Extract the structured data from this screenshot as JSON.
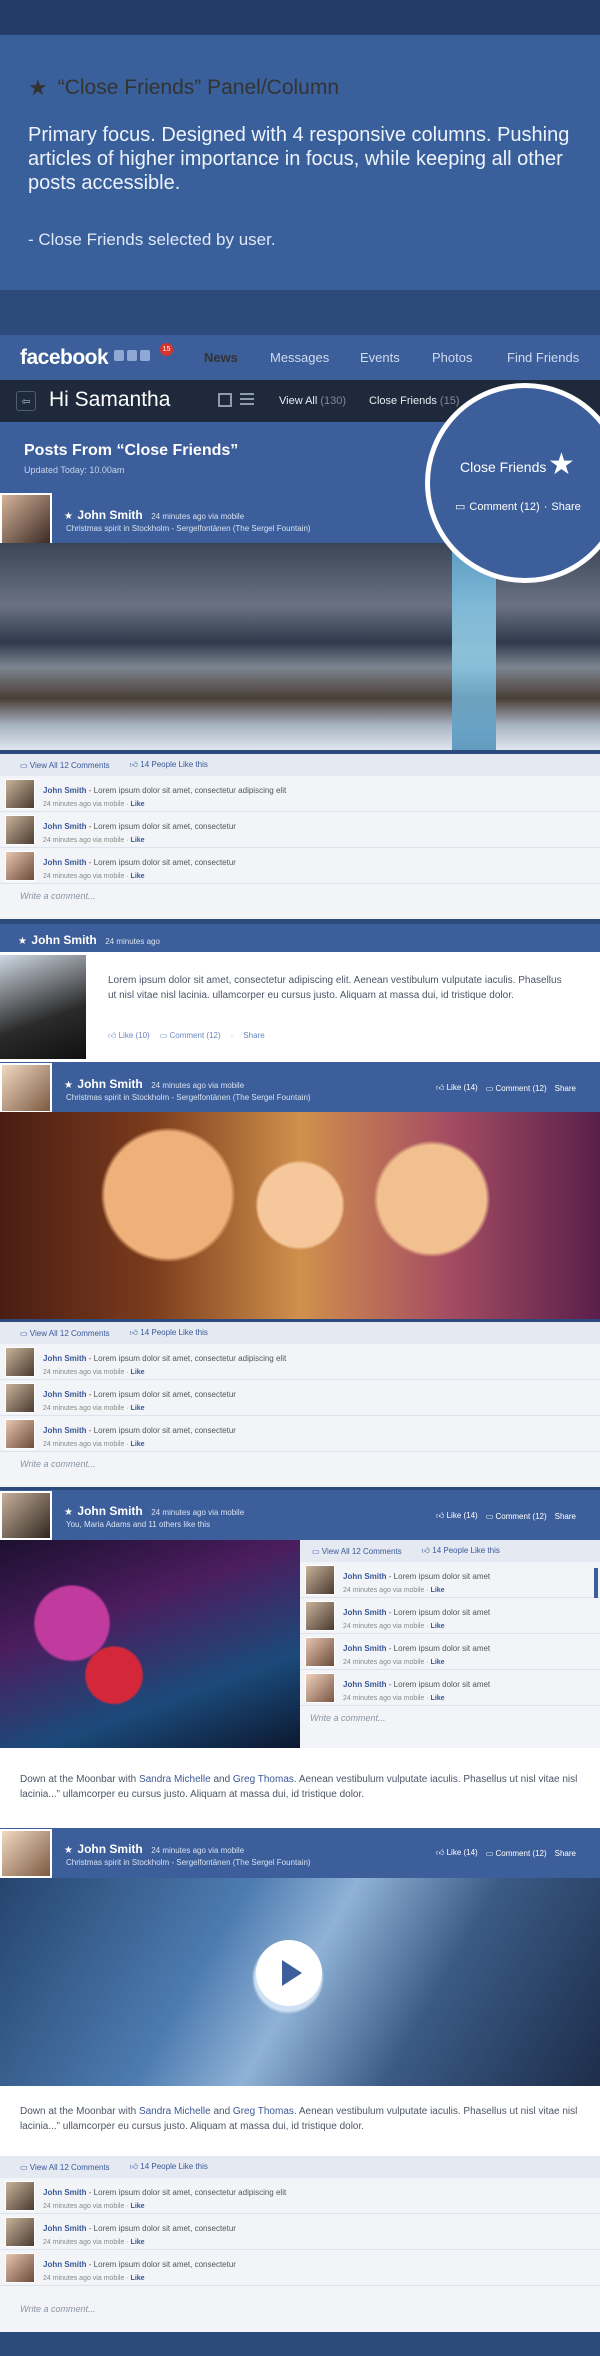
{
  "intro": {
    "title": "“Close Friends” Panel/Column",
    "body": "Primary focus. Designed with 4 responsive columns. Pushing articles of higher importance in focus, while keeping all other posts accessible.",
    "note": "- Close Friends selected by user."
  },
  "nav": {
    "logo": "facebook",
    "notification_count": "15",
    "links": [
      "News",
      "Messages",
      "Events",
      "Photos",
      "Find Friends"
    ]
  },
  "subnav": {
    "greeting": "Hi Samantha",
    "view_all_label": "View All",
    "view_all_count": "(130)",
    "close_friends_label": "Close Friends",
    "close_friends_count": "(15)"
  },
  "panel": {
    "title": "Posts From “Close Friends”",
    "updated": "Updated Today: 10.00am"
  },
  "callout": {
    "title": "Close Friends",
    "comment": "Comment (12)",
    "share": "Share"
  },
  "post1": {
    "name": "John Smith",
    "meta": "24 minutes ago via mobile",
    "caption": "Christmas spirit in Stockholm - Sergelfontänen (The Sergel Fountain)",
    "view_all": "View All 12 Comments",
    "likes": "14 People Like this"
  },
  "comment": {
    "name": "John Smith",
    "text1": " - Lorem ipsum dolor sit amet, consectetur adipiscing elit",
    "text2": " - Lorem ipsum dolor sit amet, consectetur",
    "meta": "24 minutes ago via mobile · ",
    "like": "Like",
    "write": "Write a comment..."
  },
  "comment_short": {
    "text": " - Lorem ipsum dolor sit amet"
  },
  "post2": {
    "name": "John Smith",
    "meta": "24 minutes ago",
    "body": "Lorem ipsum dolor sit amet, consectetur adipiscing elit. Aenean vestibulum vulputate iaculis. Phasellus ut nisl vitae nisl lacinia. ullamcorper eu cursus justo. Aliquam at massa dui, id tristique dolor.",
    "like": "Like (10)",
    "comment": "Comment (12)",
    "share": "Share"
  },
  "post3": {
    "name": "John Smith",
    "meta": "24 minutes ago via mobile",
    "caption": "Christmas spirit in Stockholm - Sergelfontänen (The Sergel Fountain)",
    "like": "Like (14)",
    "comment": "Comment (12)",
    "share": "Share",
    "view_all": "View All 12 Comments",
    "likes": "14 People Like this"
  },
  "post4": {
    "name": "John Smith",
    "meta": "24 minutes ago via mobile",
    "sub": "You, Maria Adams and 11 others like this",
    "like": "Like (14)",
    "comment": "Comment (12)",
    "share": "Share",
    "view_all": "View All 12 Comments",
    "likes": "14 People Like this",
    "body_pre": "Down at the Moonbar with ",
    "tag1": "Sandra Michelle",
    "and": " and ",
    "tag2": "Greg Thomas",
    "body_post": ". Aenean vestibulum vulputate iaculis. Phasellus ut nisl vitae nisl lacinia...” ullamcorper eu cursus justo. Aliquam at massa dui, id tristique dolor."
  },
  "post5": {
    "name": "John Smith",
    "meta": "24 minutes ago via mobile",
    "caption": "Christmas spirit in Stockholm - Sergelfontänen (The Sergel Fountain)",
    "like": "Like (14)",
    "comment": "Comment (12)",
    "share": "Share",
    "view_all": "View All 12 Comments",
    "likes": "14 People Like this"
  },
  "colors": {
    "accent": "#3c5e9a",
    "intro_bg": "#3a609c",
    "subnav_bg": "#1e2a3b"
  }
}
